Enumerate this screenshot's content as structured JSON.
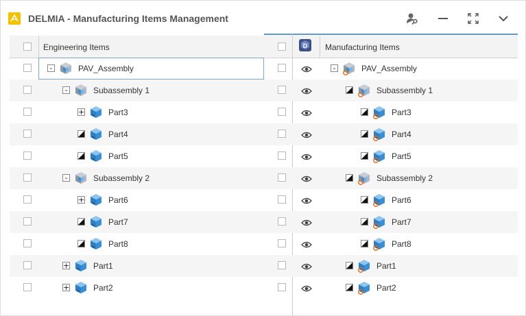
{
  "app": {
    "title": "DELMIA - Manufacturing Items Management"
  },
  "colors": {
    "accent": "#5b9bd5",
    "part_blue": "#3a8fd4",
    "alt_row": "#f5f5f5",
    "link_orange": "#e07020"
  },
  "toolbar": {
    "icons": [
      "user-key-icon",
      "minimize-icon",
      "fullscreen-icon",
      "chevron-down-icon"
    ]
  },
  "engineering": {
    "header": "Engineering Items",
    "rows": [
      {
        "label": "PAV_Assembly",
        "level": 0,
        "toggle": "-",
        "icon": "assembly"
      },
      {
        "label": "Subassembly 1",
        "level": 1,
        "toggle": "-",
        "icon": "assembly"
      },
      {
        "label": "Part3",
        "level": 2,
        "toggle": "+",
        "icon": "part"
      },
      {
        "label": "Part4",
        "level": 2,
        "toggle": "tri",
        "icon": "part"
      },
      {
        "label": "Part5",
        "level": 2,
        "toggle": "tri",
        "icon": "part"
      },
      {
        "label": "Subassembly 2",
        "level": 1,
        "toggle": "-",
        "icon": "assembly"
      },
      {
        "label": "Part6",
        "level": 2,
        "toggle": "+",
        "icon": "part"
      },
      {
        "label": "Part7",
        "level": 2,
        "toggle": "tri",
        "icon": "part"
      },
      {
        "label": "Part8",
        "level": 2,
        "toggle": "tri",
        "icon": "part"
      },
      {
        "label": "Part1",
        "level": 1,
        "toggle": "+",
        "icon": "part"
      },
      {
        "label": "Part2",
        "level": 1,
        "toggle": "+",
        "icon": "part"
      }
    ]
  },
  "manufacturing": {
    "header": "Manufacturing Items",
    "rows": [
      {
        "label": "PAV_Assembly",
        "level": 0,
        "toggle": "-",
        "icon": "mfg-assembly"
      },
      {
        "label": "Subassembly 1",
        "level": 1,
        "toggle": "tri",
        "icon": "mfg-assembly"
      },
      {
        "label": "Part3",
        "level": 2,
        "toggle": "tri",
        "icon": "mfg-part"
      },
      {
        "label": "Part4",
        "level": 2,
        "toggle": "tri",
        "icon": "mfg-part"
      },
      {
        "label": "Part5",
        "level": 2,
        "toggle": "tri",
        "icon": "mfg-part"
      },
      {
        "label": "Subassembly 2",
        "level": 1,
        "toggle": "tri",
        "icon": "mfg-assembly"
      },
      {
        "label": "Part6",
        "level": 2,
        "toggle": "tri",
        "icon": "mfg-part"
      },
      {
        "label": "Part7",
        "level": 2,
        "toggle": "tri",
        "icon": "mfg-part"
      },
      {
        "label": "Part8",
        "level": 2,
        "toggle": "tri",
        "icon": "mfg-part"
      },
      {
        "label": "Part1",
        "level": 1,
        "toggle": "tri",
        "icon": "mfg-part"
      },
      {
        "label": "Part2",
        "level": 1,
        "toggle": "tri",
        "icon": "mfg-part"
      }
    ]
  }
}
